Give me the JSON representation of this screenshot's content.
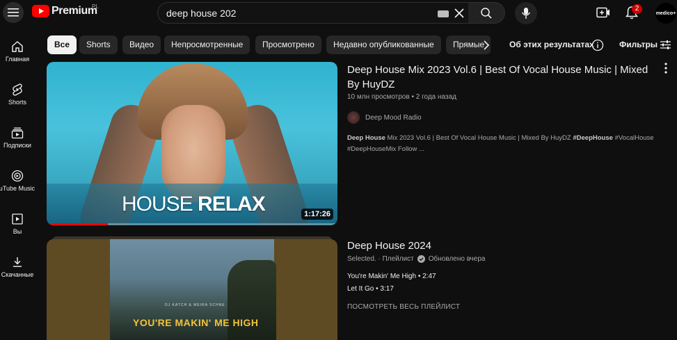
{
  "header": {
    "brand": "Premium",
    "region": "PL",
    "search_value": "deep house 202",
    "notification_count": "2",
    "avatar_text": "medico+"
  },
  "sidebar": {
    "items": [
      {
        "label": "Главная",
        "icon": "home-icon"
      },
      {
        "label": "Shorts",
        "icon": "shorts-icon"
      },
      {
        "label": "Подписки",
        "icon": "subscriptions-icon"
      },
      {
        "label": "YouTube Music",
        "icon": "youtube-music-icon"
      },
      {
        "label": "Вы",
        "icon": "library-icon"
      },
      {
        "label": "Скачанные",
        "icon": "download-icon"
      }
    ]
  },
  "chips": [
    {
      "label": "Все"
    },
    {
      "label": "Shorts"
    },
    {
      "label": "Видео"
    },
    {
      "label": "Непросмотренные"
    },
    {
      "label": "Просмотрено"
    },
    {
      "label": "Недавно опубликованные"
    },
    {
      "label": "Прямые"
    }
  ],
  "filterbar": {
    "about": "Об этих результатах",
    "filters": "Фильтры"
  },
  "results": [
    {
      "thumb_text_light": "HOUSE ",
      "thumb_text_bold": "RELAX",
      "duration": "1:17:26",
      "watched_fraction": 0.21,
      "title": "Deep House Mix 2023 Vol.6 | Best Of Vocal House Music | Mixed By HuyDZ",
      "meta": "10 млн просмотров • 2 года назад",
      "channel": "Deep Mood Radio",
      "desc_bold_1": "Deep House",
      "desc_text_1": " Mix 2023 Vol.6 | Best Of Vocal House Music | Mixed By HuyDZ ",
      "desc_bold_2": "#DeepHouse",
      "desc_text_2": " #VocalHouse #DeepHouseMix Follow ..."
    },
    {
      "thumb_credit": "DJ KATCH & MEIRA SCHNE",
      "thumb_title": "YOU'RE MAKIN' ME HIGH",
      "title": "Deep House 2024",
      "channel": "Selected.",
      "type": "Плейлист",
      "updated": "Обновлено вчера",
      "tracks": [
        "You're Makin' Me High • 2:47",
        "Let It Go • 3:17"
      ],
      "view_all": "ПОСМОТРЕТЬ ВЕСЬ ПЛЕЙЛИСТ"
    }
  ],
  "colors": {
    "background": "#0f0f0f",
    "brand_red": "#ff0000",
    "chip_bg": "#272727",
    "chip_active_bg": "#f1f1f1",
    "secondary_text": "#aaaaaa"
  }
}
